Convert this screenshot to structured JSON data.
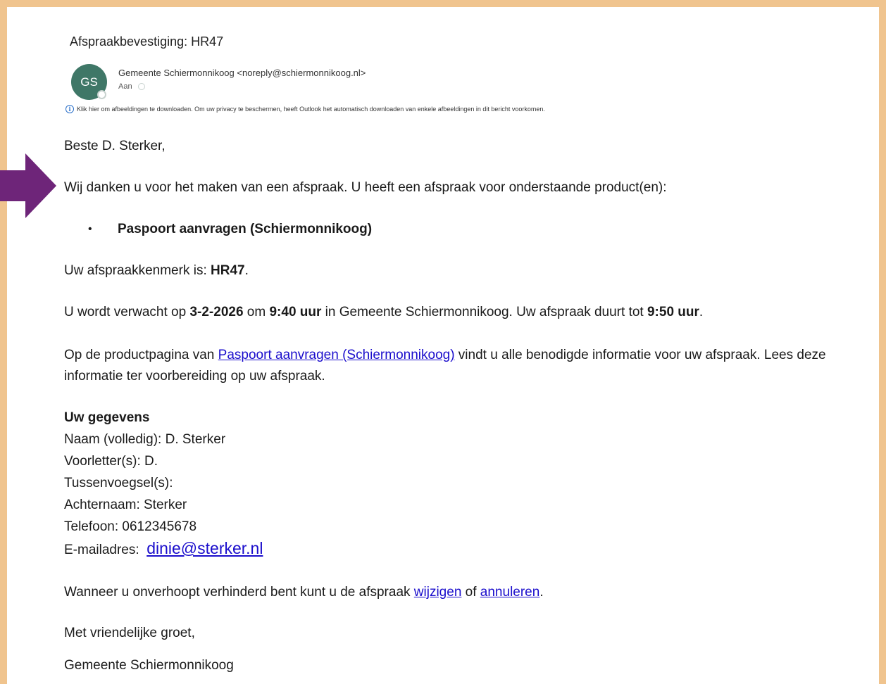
{
  "email": {
    "subject": "Afspraakbevestiging: HR47",
    "avatar_initials": "GS",
    "sender": "Gemeente Schiermonnikoog <noreply@schiermonnikoog.nl>",
    "to_label": "Aan",
    "info_bar": "Klik hier om afbeeldingen te downloaden. Om uw privacy te beschermen, heeft Outlook het automatisch downloaden van enkele afbeeldingen in dit bericht voorkomen.",
    "info_icon": "i"
  },
  "body": {
    "greeting": "Beste D. Sterker,",
    "thanks": "Wij danken u voor het maken van een afspraak. U heeft een afspraak voor onderstaande product(en):",
    "product": "Paspoort aanvragen (Schiermonnikoog)",
    "ref_prefix": "Uw afspraakkenmerk is: ",
    "ref_code": "HR47",
    "ref_suffix": ".",
    "time_1": "U wordt verwacht op ",
    "date": "3-2-2026",
    "time_2": " om ",
    "start_time": "9:40 uur",
    "time_3": " in Gemeente Schiermonnikoog. Uw afspraak duurt tot ",
    "end_time": "9:50 uur",
    "time_4": ".",
    "info_1": "Op de productpagina van ",
    "info_link": "Paspoort aanvragen (Schiermonnikoog)",
    "info_2": " vindt u alle benodigde informatie voor uw afspraak. Lees deze informatie ter voorbereiding op uw afspraak.",
    "details_heading": "Uw gegevens",
    "name": "Naam (volledig): D. Sterker",
    "initials": "Voorletter(s): D.",
    "infix": "Tussenvoegsel(s):",
    "surname": "Achternaam: Sterker",
    "phone": "Telefoon: 0612345678",
    "email_label": "E-mailadres: ",
    "email_value": "dinie@sterker.nl",
    "change_1": "Wanneer u onverhoopt verhinderd bent kunt u de afspraak ",
    "change_link": "wijzigen",
    "change_2": " of ",
    "cancel_link": "annuleren",
    "change_3": ".",
    "closing": "Met vriendelijke groet,",
    "signature": "Gemeente Schiermonnikoog"
  },
  "colors": {
    "frame": "#f0c48e",
    "arrow": "#6e2579",
    "avatar": "#3f7767",
    "link": "#1a0dcc"
  },
  "icons": {
    "arrow": "arrow-right-icon",
    "info": "info-icon",
    "presence": "presence-status-icon"
  }
}
